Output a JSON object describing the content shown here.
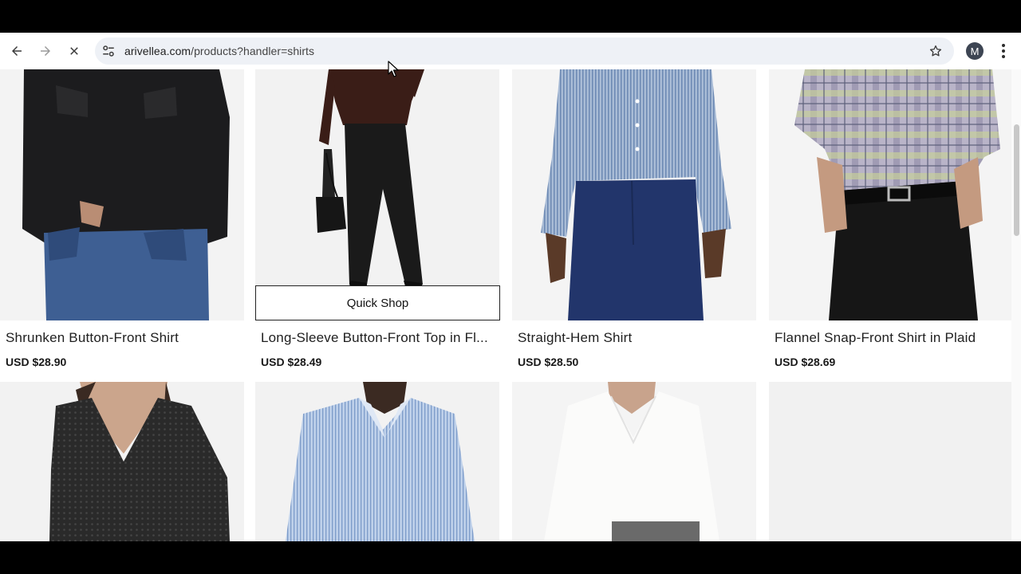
{
  "browser": {
    "url_domain": "arivellea.com",
    "url_path": "/products?handler=shirts",
    "profile_initial": "M"
  },
  "products": [
    {
      "name": "Shrunken Button-Front Shirt",
      "price": "USD $28.90"
    },
    {
      "name": "Long-Sleeve Button-Front Top in Fl...",
      "price": "USD $28.49",
      "quick_shop_label": "Quick Shop"
    },
    {
      "name": "Straight-Hem Shirt",
      "price": "USD $28.50"
    },
    {
      "name": "Flannel Snap-Front Shirt in Plaid",
      "price": "USD $28.69"
    }
  ]
}
